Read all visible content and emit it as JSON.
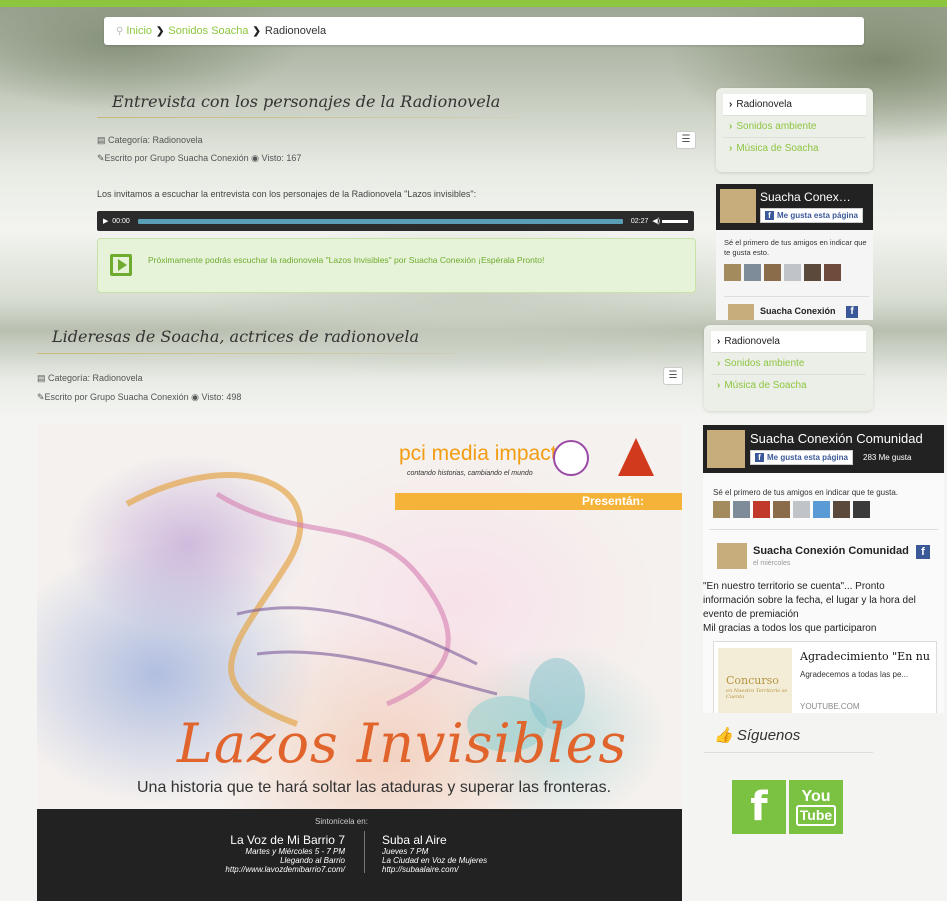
{
  "breadcrumb": {
    "home": "Inicio",
    "section": "Sonidos Soacha",
    "current": "Radionovela"
  },
  "article1": {
    "title": "Entrevista con los personajes de la Radionovela",
    "category": "Categoría: Radionovela",
    "author": "Escrito por Grupo Suacha Conexión",
    "views": "Visto: 167",
    "intro": "Los invitamos a escuchar la entrevista con los personajes de la Radionovela \"Lazos invisibles\":",
    "audio": {
      "current": "00:00",
      "duration": "02:27",
      "progress": 0
    },
    "notice": "Próximamente podrás escuchar la radionovela \"Lazos Invisibles\" por Suacha Conexión ¡Espérala Pronto!"
  },
  "article2": {
    "title": "Lideresas de Soacha, actrices de radionovela",
    "category": "Categoría: Radionovela",
    "author": "Escrito por Grupo Suacha Conexión",
    "views": "Visto: 498"
  },
  "poster": {
    "brand": "pci media impact",
    "brand_tag": "contando historias, cambiando el mundo",
    "present": "Presentán:",
    "title": "Lazos Invisibles",
    "tagline": "Una historia que te hará soltar las ataduras y superar las fronteras.",
    "tune_in": "Sintonícela en:",
    "st1": {
      "name": "La Voz de Mi Barrio 7",
      "time": "Martes y Miércoles 5 - 7 PM",
      "show": "Llegando al Barrio",
      "url": "http://www.lavozdemibarrio7.com/"
    },
    "st2": {
      "name": "Suba al Aire",
      "time": "Jueves 7 PM",
      "show": "La Ciudad en Voz de Mujeres",
      "url": "http://subaalaire.com/"
    }
  },
  "sidebar1": {
    "items": [
      "Radionovela",
      "Sonidos ambiente",
      "Música de Soacha"
    ]
  },
  "fb1": {
    "page": "Suacha Conex…",
    "like": "Me gusta esta página",
    "friends": "Sé el primero de tus amigos en indicar que te gusta esto.",
    "post_author": "Suacha Conexión"
  },
  "sidebar2": {
    "items": [
      "Radionovela",
      "Sonidos ambiente",
      "Música de Soacha"
    ]
  },
  "fb2": {
    "page": "Suacha Conexión Comunidad",
    "like": "Me gusta esta página",
    "count": "283 Me gusta",
    "friends": "Sé el primero de tus amigos en indicar que te gusta.",
    "post_author": "Suacha Conexión Comunidad",
    "post_date": "el miércoles",
    "post_text": "\"En nuestro territorio se cuenta\"... Pronto información sobre la fecha, el lugar y la hora del evento de premiación",
    "post_text2": "Mil gracias a todos los que participaron",
    "link_title": "Agradecimiento \"En nu",
    "link_desc": "Agradecemos a todas las pe...",
    "link_domain": "YOUTUBE.COM",
    "contest": "Concurso",
    "contest_sub": "en Nuestro Territorio se Cuenta"
  },
  "follow": {
    "title": "Síguenos",
    "fb": "f",
    "yt1": "You",
    "yt2": "Tube"
  },
  "colors": {
    "accent": "#8cc63f",
    "facebook": "#3b5998",
    "dark": "#222222"
  }
}
